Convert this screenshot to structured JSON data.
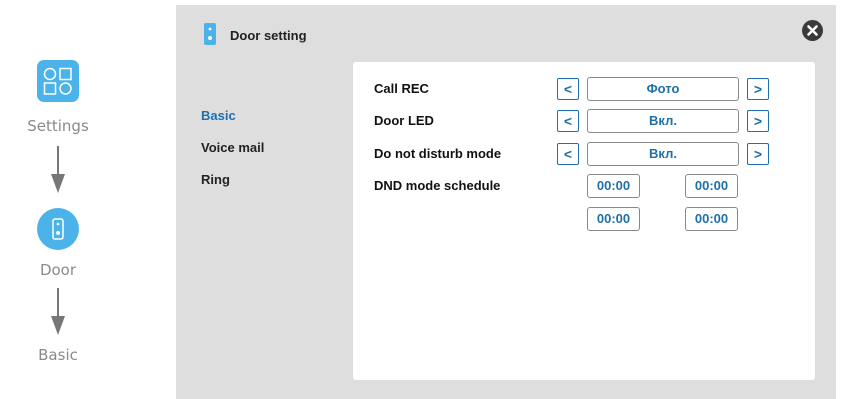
{
  "flow": {
    "steps": [
      "Settings",
      "Door",
      "Basic"
    ]
  },
  "window": {
    "title": "Door setting"
  },
  "menu": {
    "items": [
      "Basic",
      "Voice mail",
      "Ring"
    ],
    "active": "Basic"
  },
  "settings": {
    "call_rec": {
      "label": "Call REC",
      "value": "Фото"
    },
    "door_led": {
      "label": "Door LED",
      "value": "Вкл."
    },
    "dnd_mode": {
      "label": "Do not disturb mode",
      "value": "Вкл."
    },
    "dnd_schedule": {
      "label": "DND mode schedule",
      "times": [
        "00:00",
        "00:00",
        "00:00",
        "00:00"
      ]
    }
  },
  "controls": {
    "prev_symbol": "<",
    "next_symbol": ">"
  },
  "icons": {
    "settings": "grid-icon",
    "door": "doorbell-icon",
    "close": "close-icon"
  },
  "colors": {
    "accent": "#4cb3ea",
    "value_text": "#1f6fa8",
    "panel_bg": "#dedede",
    "active_menu": "#1e6fb0"
  }
}
